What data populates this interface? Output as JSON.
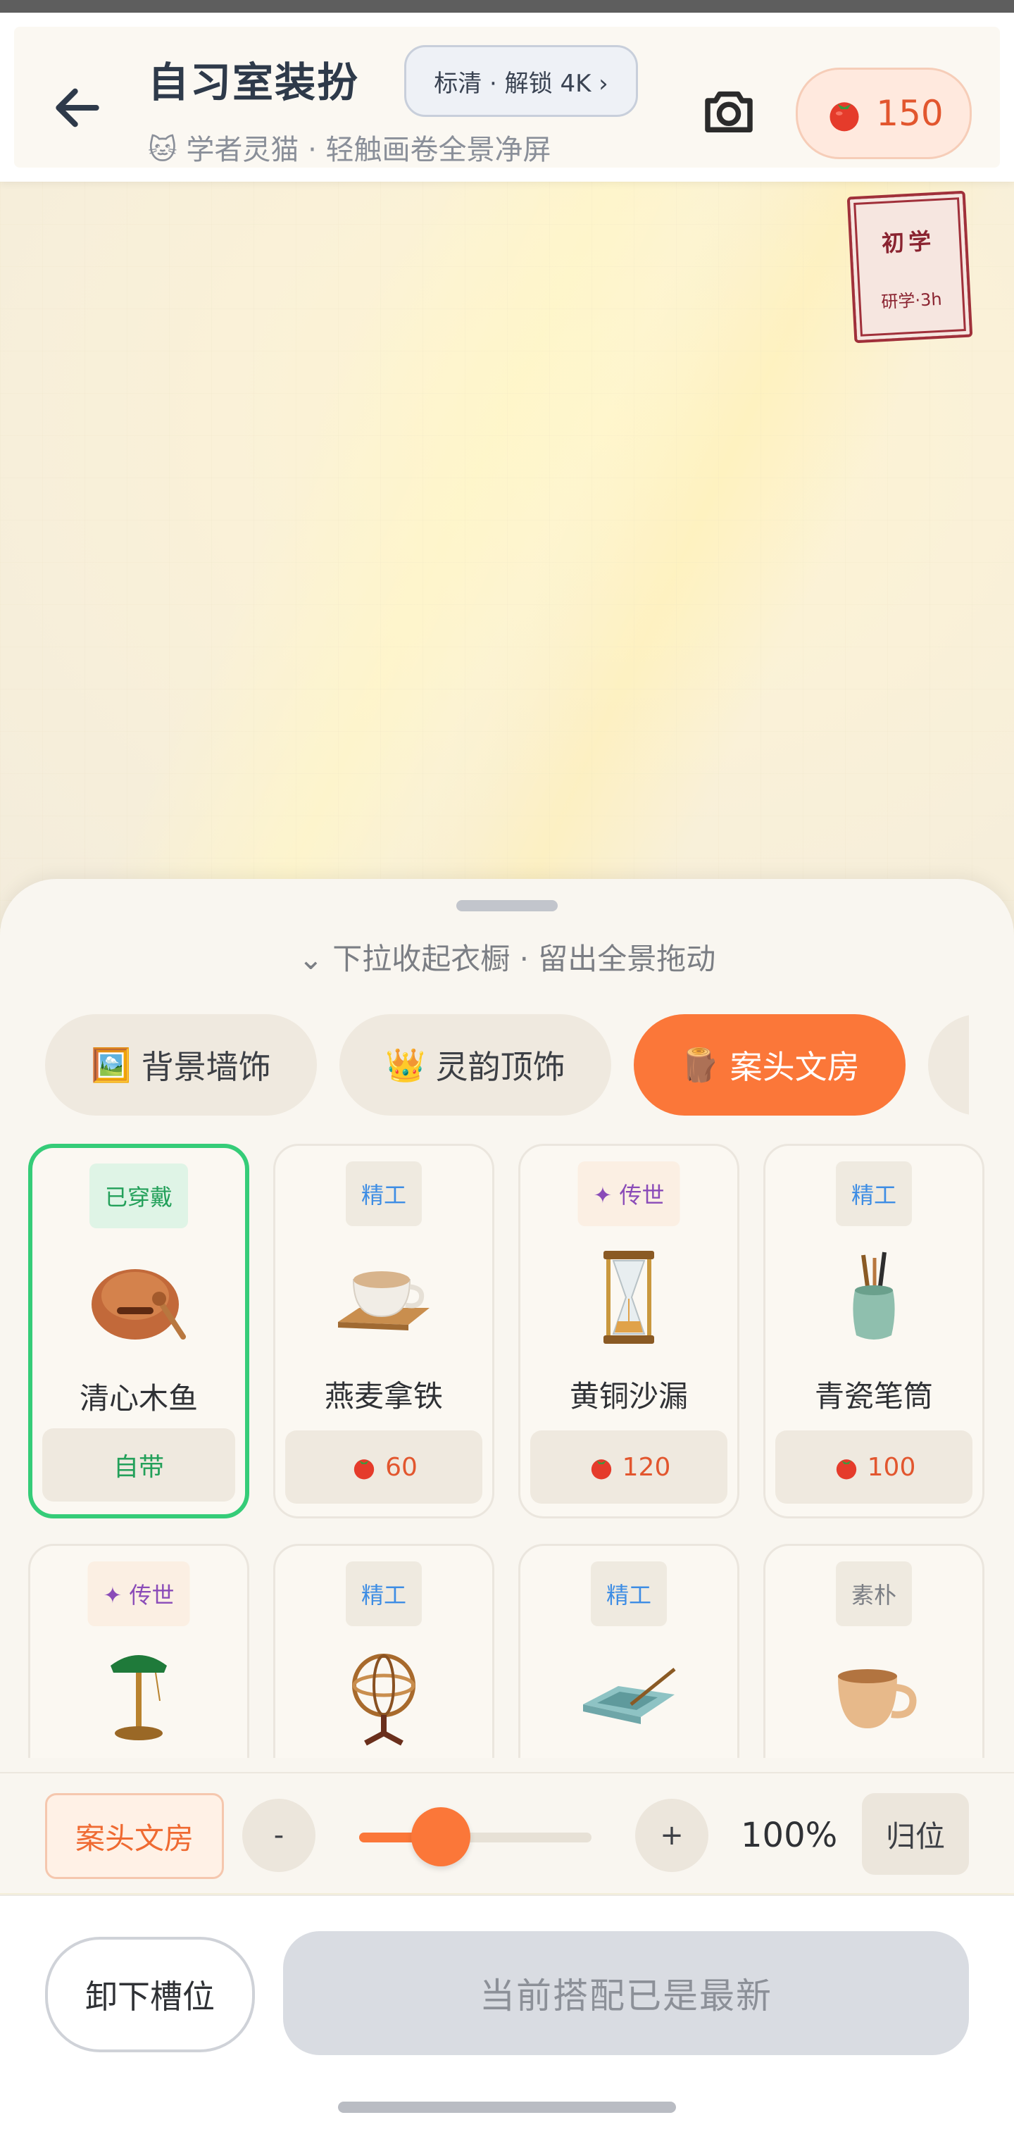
{
  "header": {
    "title": "自习室装扮",
    "quality_label": "标清 · 解锁 4K ›",
    "subtitle": "🐱 学者灵猫 · 轻触画卷全景净屏",
    "coins": "150"
  },
  "stamp": {
    "main": "初学",
    "sub": "研学·3h"
  },
  "sheet": {
    "hint": "⌄  下拉收起衣橱 · 留出全景拖动",
    "tabs": [
      {
        "icon": "🖼️",
        "label": "背景墙饰",
        "active": false
      },
      {
        "icon": "👑",
        "label": "灵韵顶饰",
        "active": false
      },
      {
        "icon": "🪵",
        "label": "案头文房",
        "active": true
      }
    ],
    "items": [
      {
        "badge": "已穿戴",
        "badge_style": "green",
        "name": "清心木鱼",
        "price": "自带",
        "owned": true,
        "equipped": true,
        "icon": "wooden-fish-icon"
      },
      {
        "badge": "精工",
        "badge_style": "blue",
        "name": "燕麦拿铁",
        "price": "60",
        "owned": false,
        "icon": "latte-icon"
      },
      {
        "badge": "✦ 传世",
        "badge_style": "purple",
        "name": "黄铜沙漏",
        "price": "120",
        "owned": false,
        "icon": "hourglass-icon"
      },
      {
        "badge": "精工",
        "badge_style": "blue",
        "name": "青瓷笔筒",
        "price": "100",
        "owned": false,
        "icon": "brush-holder-icon"
      },
      {
        "badge": "✦ 传世",
        "badge_style": "purple",
        "name": "",
        "price": "",
        "icon": "desk-lamp-icon"
      },
      {
        "badge": "精工",
        "badge_style": "blue",
        "name": "",
        "price": "",
        "icon": "armillary-icon"
      },
      {
        "badge": "精工",
        "badge_style": "blue",
        "name": "",
        "price": "",
        "icon": "inkstone-icon"
      },
      {
        "badge": "素朴",
        "badge_style": "gray",
        "name": "",
        "price": "",
        "icon": "mug-icon"
      }
    ]
  },
  "controls": {
    "slot_label": "案头文房",
    "minus": "-",
    "plus": "+",
    "zoom_text": "100%",
    "zoom_level": 0.35,
    "reset_label": "归位"
  },
  "footer": {
    "unequip_label": "卸下槽位",
    "apply_label": "当前搭配已是最新"
  },
  "colors": {
    "accent": "#fb7739",
    "equipped": "#35cc78",
    "coin": "#e2562e"
  }
}
